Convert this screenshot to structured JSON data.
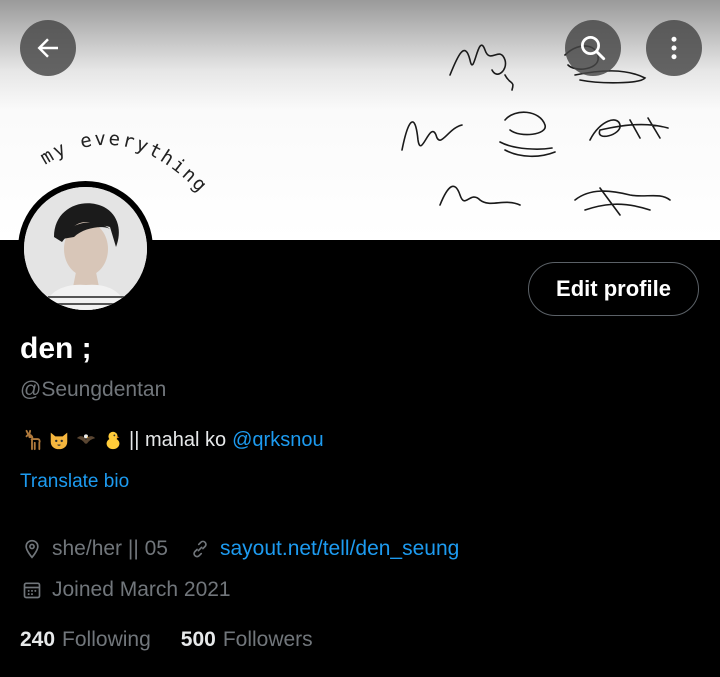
{
  "header": {
    "back_icon": "arrow-left-icon",
    "search_icon": "search-icon",
    "more_icon": "more-vertical-icon",
    "banner_text": "my everything"
  },
  "profile": {
    "display_name": "den ;",
    "handle": "@Seungdentan",
    "edit_button_label": "Edit profile",
    "bio": {
      "emojis": [
        "deer-emoji",
        "cat-face-emoji",
        "eagle-emoji",
        "baby-chick-emoji"
      ],
      "text": "|| mahal ko",
      "mention": "@qrksnou"
    },
    "translate_label": "Translate bio",
    "location": "she/her || 05",
    "website": "sayout.net/tell/den_seung",
    "joined": "Joined March 2021",
    "following_count": "240",
    "following_label": "Following",
    "followers_count": "500",
    "followers_label": "Followers"
  },
  "colors": {
    "background": "#000000",
    "accent_link": "#1d9bf0",
    "secondary_text": "#71767b",
    "primary_text": "#e7e9ea"
  }
}
